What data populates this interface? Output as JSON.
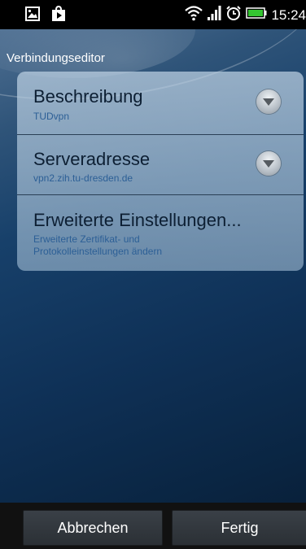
{
  "status_bar": {
    "time": "15:24",
    "icons": [
      "photo-notification-icon",
      "store-notification-icon",
      "wifi-icon",
      "signal-icon",
      "alarm-icon",
      "battery-icon"
    ]
  },
  "dialog": {
    "title": "Verbindungseditor",
    "rows": [
      {
        "title": "Beschreibung",
        "value": "TUDvpn"
      },
      {
        "title": "Serveradresse",
        "value": "vpn2.zih.tu-dresden.de"
      },
      {
        "title": "Erweiterte Einstellungen...",
        "value_line1": "Erweiterte Zertifikat- und",
        "value_line2": "Protokolleinstellungen ändern"
      }
    ]
  },
  "buttons": {
    "cancel": "Abbrechen",
    "done": "Fertig"
  },
  "colors": {
    "background_top": "#2f5479",
    "background_bottom": "#081c33",
    "subtext": "#2c5f96",
    "battery": "#34c431"
  }
}
